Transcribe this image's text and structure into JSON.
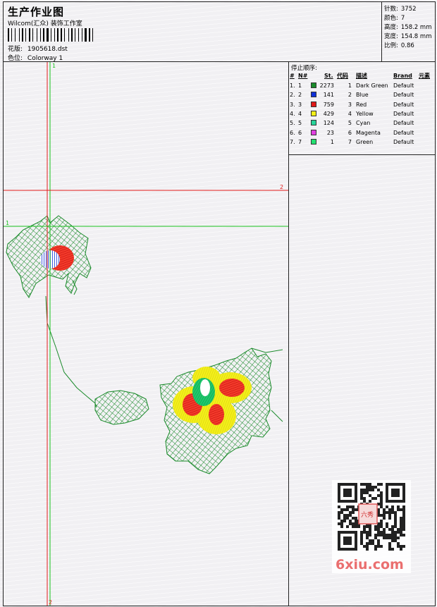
{
  "header": {
    "title": "生产作业图",
    "subtitle": "Wilcom(汇众) 装饰工作室",
    "design_label": "花版:",
    "design_value": "1905618.dst",
    "colorway_label": "色位:",
    "colorway_value": "Colorway 1"
  },
  "info": {
    "stitches_label": "针数:",
    "stitches_value": "3752",
    "colors_label": "颜色:",
    "colors_value": "7",
    "height_label": "高度:",
    "height_value": "158.2 mm",
    "width_label": "宽度:",
    "width_value": "154.8 mm",
    "scale_label": "比例:",
    "scale_value": "0.86"
  },
  "stop_sequence": {
    "title": "停止顺序:",
    "columns": [
      "#",
      "N#",
      "St.",
      "代码",
      "描述",
      "Brand",
      "元素"
    ],
    "rows": [
      {
        "num": "1.",
        "n": "1",
        "color": "#1a8a2a",
        "st": "2273",
        "code": "1",
        "desc": "Dark Green",
        "brand": "Default"
      },
      {
        "num": "2.",
        "n": "2",
        "color": "#1030d8",
        "st": "141",
        "code": "2",
        "desc": "Blue",
        "brand": "Default"
      },
      {
        "num": "3.",
        "n": "3",
        "color": "#e01818",
        "st": "759",
        "code": "3",
        "desc": "Red",
        "brand": "Default"
      },
      {
        "num": "4.",
        "n": "4",
        "color": "#f2ee18",
        "st": "429",
        "code": "4",
        "desc": "Yellow",
        "brand": "Default"
      },
      {
        "num": "5.",
        "n": "5",
        "color": "#28d49a",
        "st": "124",
        "code": "5",
        "desc": "Cyan",
        "brand": "Default"
      },
      {
        "num": "6.",
        "n": "6",
        "color": "#e040e0",
        "st": "23",
        "code": "6",
        "desc": "Magenta",
        "brand": "Default"
      },
      {
        "num": "7.",
        "n": "7",
        "color": "#22e070",
        "st": "1",
        "code": "7",
        "desc": "Green",
        "brand": "Default"
      }
    ]
  },
  "guides": {
    "green_v_label": "1",
    "green_h_label": "1",
    "red_h_label": "2",
    "red_v_label": "2"
  },
  "colors": {
    "guide_green": "#19c21e",
    "guide_red": "#e21b1b",
    "fill_dark_green": "#1a8a2a",
    "watermark": "#ea6f6f"
  },
  "watermark": {
    "text": "6xiu.com",
    "seal_text": "六秀",
    "qr": "qr-code-icon"
  }
}
